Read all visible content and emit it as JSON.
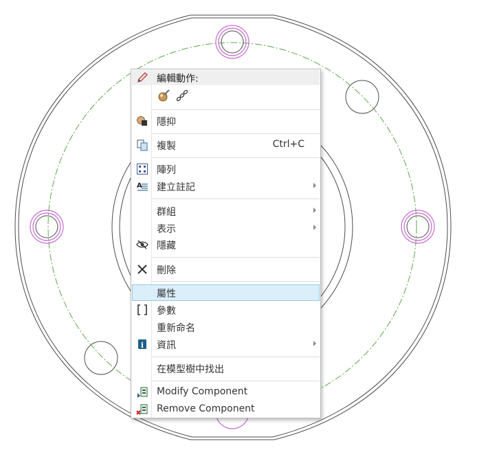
{
  "context_menu": {
    "header": "編輯動作:",
    "mini_toolbar_icons": [
      "appearance-brush-icon",
      "chain-link-icon"
    ],
    "items": [
      {
        "id": "suppress",
        "label": "隱抑",
        "icon": "suppress-icon"
      },
      {
        "id": "copy",
        "label": "複製",
        "shortcut": "Ctrl+C",
        "icon": "copy-icon"
      },
      {
        "id": "pattern",
        "label": "陣列",
        "icon": "pattern-icon"
      },
      {
        "id": "create-note",
        "label": "建立註記",
        "icon": "note-icon",
        "submenu": true
      },
      {
        "id": "group",
        "label": "群組",
        "submenu": true
      },
      {
        "id": "display",
        "label": "表示",
        "submenu": true
      },
      {
        "id": "hide",
        "label": "隱藏",
        "icon": "hide-eye-icon"
      },
      {
        "id": "delete",
        "label": "刪除",
        "icon": "delete-x-icon"
      },
      {
        "id": "properties",
        "label": "屬性",
        "highlighted": true
      },
      {
        "id": "parameters",
        "label": "參數",
        "icon": "parameters-bracket-icon"
      },
      {
        "id": "rename",
        "label": "重新命名"
      },
      {
        "id": "info",
        "label": "資訊",
        "icon": "info-icon",
        "submenu": true
      },
      {
        "id": "find-in-tree",
        "label": "在模型樹中找出"
      },
      {
        "id": "modify-component",
        "label": "Modify Component",
        "icon": "modify-component-icon"
      },
      {
        "id": "remove-component",
        "label": "Remove Component",
        "icon": "remove-component-icon"
      }
    ]
  },
  "colors": {
    "highlight_bg": "#dbeffa",
    "highlight_border": "#96c8e4",
    "drawing_lines": "#4a4a4a",
    "centerline": "#5aa64a",
    "selected_holes": "#c46ad0"
  }
}
